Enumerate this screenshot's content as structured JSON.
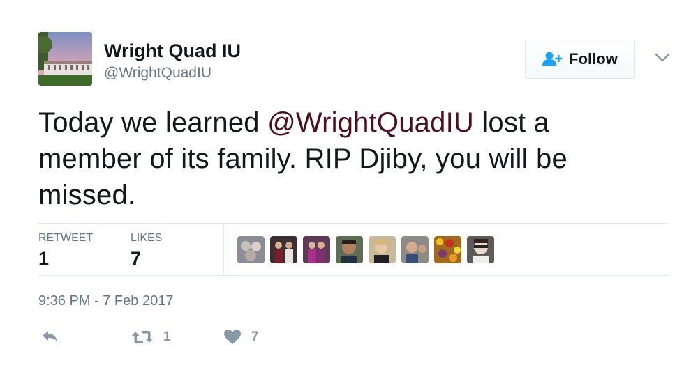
{
  "author": {
    "display_name": "Wright Quad IU",
    "handle": "@WrightQuadIU"
  },
  "follow_button": {
    "label": "Follow"
  },
  "tweet": {
    "text_before": "Today we learned ",
    "mention": "@WrightQuadIU",
    "text_after": " lost a member of its family. RIP Djiby, you will be missed."
  },
  "stats": {
    "retweet_label": "RETWEET",
    "retweet_count": "1",
    "likes_label": "LIKES",
    "likes_count": "7"
  },
  "timestamp": "9:36 PM - 7 Feb 2017",
  "actions": {
    "retweet_count": "1",
    "like_count": "7"
  },
  "colors": {
    "mention": "#4b0f1f",
    "muted": "#657786",
    "icon": "#8899a6",
    "follow_icon": "#1da1f2"
  }
}
